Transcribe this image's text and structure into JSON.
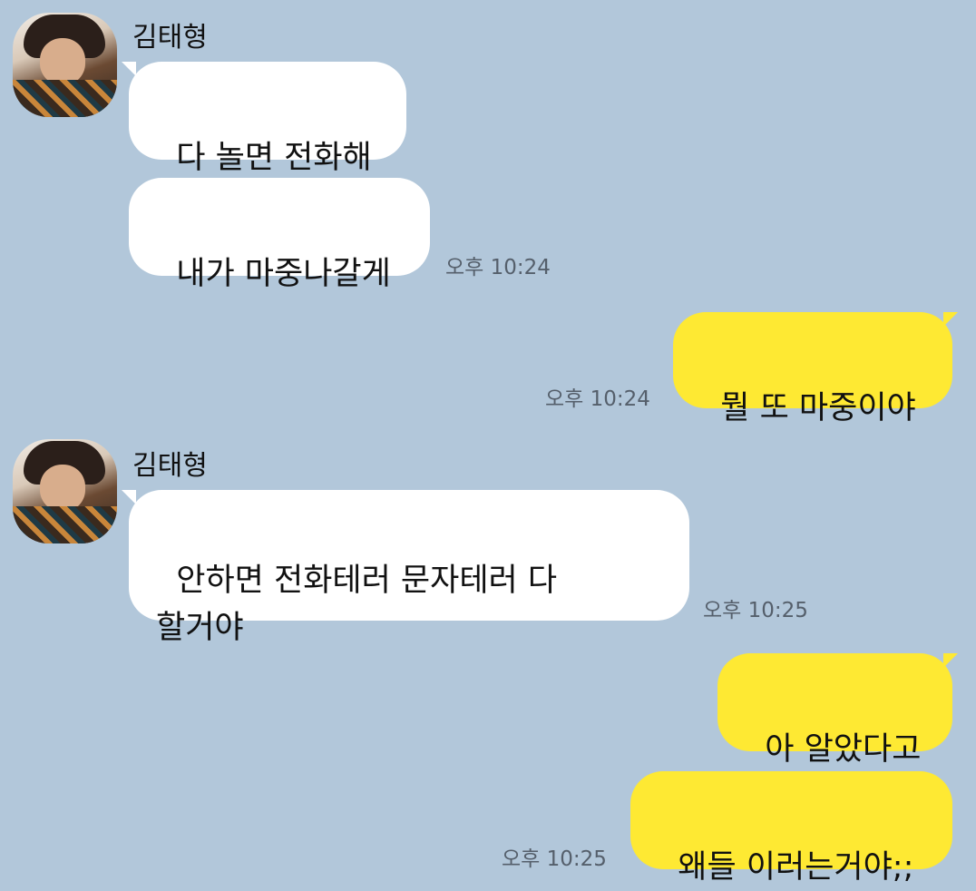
{
  "sender": "김태형",
  "messages": [
    {
      "side": "left",
      "text": "다 놀면 전화해"
    },
    {
      "side": "left",
      "text": "내가 마중나갈게",
      "time": "오후 10:24"
    },
    {
      "side": "right",
      "text": "뭘 또 마중이야",
      "time": "오후 10:24"
    },
    {
      "side": "left",
      "text": "안하면 전화테러 문자테러 다\n할거야",
      "time": "오후 10:25"
    },
    {
      "side": "right",
      "text": "아 알았다고"
    },
    {
      "side": "right",
      "text": "왜들 이러는거야;;",
      "time": "오후 10:25"
    }
  ],
  "colors": {
    "background": "#b2c7da",
    "incoming": "#ffffff",
    "outgoing": "#fee933"
  }
}
